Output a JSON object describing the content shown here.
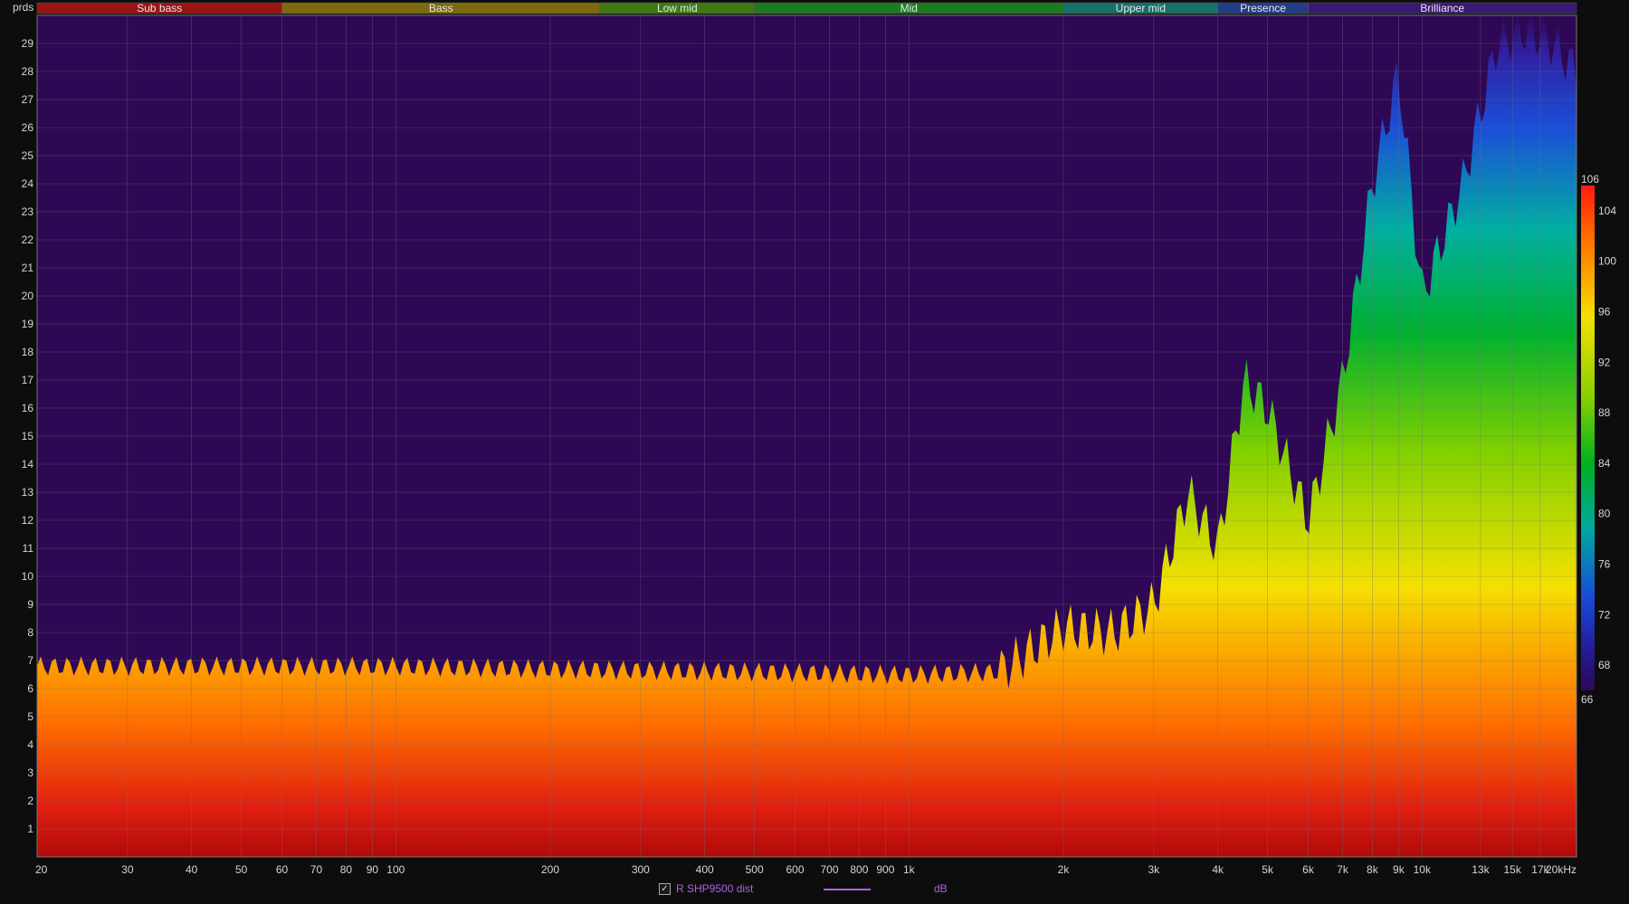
{
  "chart_data": {
    "type": "heatmap",
    "title": "",
    "y_unit_label": "prds",
    "x_scale": "log",
    "xlim": [
      20,
      20000
    ],
    "ylim": [
      0,
      30
    ],
    "x_ticks": [
      {
        "v": 20,
        "label": "20"
      },
      {
        "v": 30,
        "label": "30"
      },
      {
        "v": 40,
        "label": "40"
      },
      {
        "v": 50,
        "label": "50"
      },
      {
        "v": 60,
        "label": "60"
      },
      {
        "v": 70,
        "label": "70"
      },
      {
        "v": 80,
        "label": "80"
      },
      {
        "v": 90,
        "label": "90"
      },
      {
        "v": 100,
        "label": "100"
      },
      {
        "v": 200,
        "label": "200"
      },
      {
        "v": 300,
        "label": "300"
      },
      {
        "v": 400,
        "label": "400"
      },
      {
        "v": 500,
        "label": "500"
      },
      {
        "v": 600,
        "label": "600"
      },
      {
        "v": 700,
        "label": "700"
      },
      {
        "v": 800,
        "label": "800"
      },
      {
        "v": 900,
        "label": "900"
      },
      {
        "v": 1000,
        "label": "1k"
      },
      {
        "v": 2000,
        "label": "2k"
      },
      {
        "v": 3000,
        "label": "3k"
      },
      {
        "v": 4000,
        "label": "4k"
      },
      {
        "v": 5000,
        "label": "5k"
      },
      {
        "v": 6000,
        "label": "6k"
      },
      {
        "v": 7000,
        "label": "7k"
      },
      {
        "v": 8000,
        "label": "8k"
      },
      {
        "v": 9000,
        "label": "9k"
      },
      {
        "v": 10000,
        "label": "10k"
      },
      {
        "v": 13000,
        "label": "13k"
      },
      {
        "v": 15000,
        "label": "15k"
      },
      {
        "v": 17000,
        "label": "17k"
      },
      {
        "v": 20000,
        "label": "20kHz"
      }
    ],
    "y_ticks": [
      1,
      2,
      3,
      4,
      5,
      6,
      7,
      8,
      9,
      10,
      11,
      12,
      13,
      14,
      15,
      16,
      17,
      18,
      19,
      20,
      21,
      22,
      23,
      24,
      25,
      26,
      27,
      28,
      29
    ],
    "bands": [
      {
        "name": "Sub bass",
        "from": 20,
        "to": 60,
        "color": "#9a1414"
      },
      {
        "name": "Bass",
        "from": 60,
        "to": 250,
        "color": "#7d6a10"
      },
      {
        "name": "Low mid",
        "from": 250,
        "to": 500,
        "color": "#3f7a12"
      },
      {
        "name": "Mid",
        "from": 500,
        "to": 2000,
        "color": "#1d7a22"
      },
      {
        "name": "Upper mid",
        "from": 2000,
        "to": 4000,
        "color": "#17706a"
      },
      {
        "name": "Presence",
        "from": 4000,
        "to": 6000,
        "color": "#233c86"
      },
      {
        "name": "Brilliance",
        "from": 6000,
        "to": 20000,
        "color": "#3a1a72"
      }
    ],
    "colorbar": {
      "unit": "dB",
      "min": 66,
      "max": 106,
      "ticks": [
        106,
        104,
        100,
        96,
        92,
        88,
        84,
        80,
        76,
        72,
        68,
        66
      ]
    },
    "decay_profile": [
      {
        "x": 20,
        "y": 6.8
      },
      {
        "x": 50,
        "y": 6.8
      },
      {
        "x": 100,
        "y": 6.8
      },
      {
        "x": 200,
        "y": 6.7
      },
      {
        "x": 500,
        "y": 6.6
      },
      {
        "x": 1000,
        "y": 6.5
      },
      {
        "x": 1500,
        "y": 6.6
      },
      {
        "x": 2000,
        "y": 8.2
      },
      {
        "x": 2500,
        "y": 8.0
      },
      {
        "x": 3000,
        "y": 9.0
      },
      {
        "x": 3500,
        "y": 13.0
      },
      {
        "x": 4000,
        "y": 11.0
      },
      {
        "x": 4500,
        "y": 17.0
      },
      {
        "x": 5000,
        "y": 16.0
      },
      {
        "x": 6000,
        "y": 12.0
      },
      {
        "x": 7000,
        "y": 17.0
      },
      {
        "x": 8000,
        "y": 24.0
      },
      {
        "x": 9000,
        "y": 28.0
      },
      {
        "x": 10000,
        "y": 20.0
      },
      {
        "x": 12000,
        "y": 24.0
      },
      {
        "x": 14000,
        "y": 29.0
      },
      {
        "x": 16000,
        "y": 29.5
      },
      {
        "x": 18000,
        "y": 29.0
      },
      {
        "x": 20000,
        "y": 28.0
      }
    ],
    "series": [
      {
        "name": "R SHP9500 dist"
      }
    ]
  },
  "legend": {
    "series_name": "R SHP9500 dist",
    "checked": "✓",
    "unit": "dB",
    "line_color": "#b061e6"
  },
  "colors": {
    "background": "#0d0d0d",
    "plot_background": "#2e0854",
    "grid": "#6f6f80"
  }
}
